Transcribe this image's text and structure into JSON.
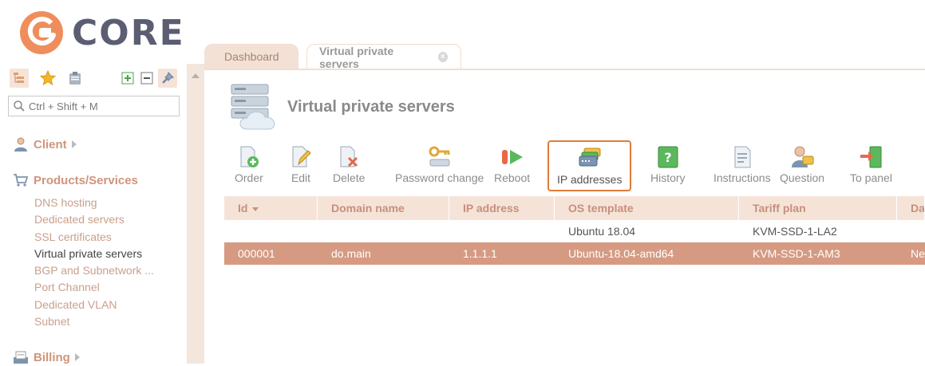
{
  "logo": {
    "text": "CORE",
    "brand_color": "#ef8e5c"
  },
  "sidebar": {
    "search": {
      "placeholder": "Ctrl + Shift + M"
    },
    "groups": [
      {
        "label": "Client",
        "icon": "user-icon"
      },
      {
        "label": "Products/Services",
        "icon": "cart-icon"
      },
      {
        "label": "Billing",
        "icon": "billing-icon"
      }
    ],
    "items": [
      {
        "label": "DNS hosting"
      },
      {
        "label": "Dedicated servers"
      },
      {
        "label": "SSL certificates"
      },
      {
        "label": "Virtual private servers",
        "current": true
      },
      {
        "label": "BGP and Subnetwork ..."
      },
      {
        "label": "Port Channel"
      },
      {
        "label": "Dedicated VLAN"
      },
      {
        "label": "Subnet"
      }
    ]
  },
  "tabs": [
    {
      "label": "Dashboard"
    },
    {
      "label": "Virtual private servers",
      "active": true
    }
  ],
  "page": {
    "title": "Virtual private servers"
  },
  "toolbar": {
    "buttons": [
      {
        "label": "Order",
        "icon": "order-icon"
      },
      {
        "label": "Edit",
        "icon": "edit-icon"
      },
      {
        "label": "Delete",
        "icon": "delete-icon"
      },
      {
        "label": "Password change",
        "icon": "key-icon"
      },
      {
        "label": "Reboot",
        "icon": "reboot-icon"
      },
      {
        "label": "IP addresses",
        "icon": "ip-addresses-icon",
        "highlighted": true
      },
      {
        "label": "History",
        "icon": "history-icon"
      },
      {
        "label": "Instructions",
        "icon": "instructions-icon"
      },
      {
        "label": "Question",
        "icon": "question-icon"
      },
      {
        "label": "To panel",
        "icon": "to-panel-icon"
      }
    ]
  },
  "grid": {
    "columns": [
      "Id",
      "Domain name",
      "IP address",
      "OS template",
      "Tariff plan",
      "Da"
    ],
    "rows": [
      {
        "id": "",
        "domain": "",
        "ip": "",
        "os": "Ubuntu 18.04",
        "tariff": "KVM-SSD-1-LA2",
        "da": ""
      },
      {
        "id": "000001",
        "domain": "do.main",
        "ip": "1.1.1.1",
        "os": "Ubuntu-18.04-amd64",
        "tariff": "KVM-SSD-1-AM3",
        "da": "Ne",
        "selected": true
      }
    ]
  },
  "colors": {
    "accent": "#d69a82",
    "header_bg": "#f6e3d8",
    "highlight_border": "#e07b39"
  }
}
